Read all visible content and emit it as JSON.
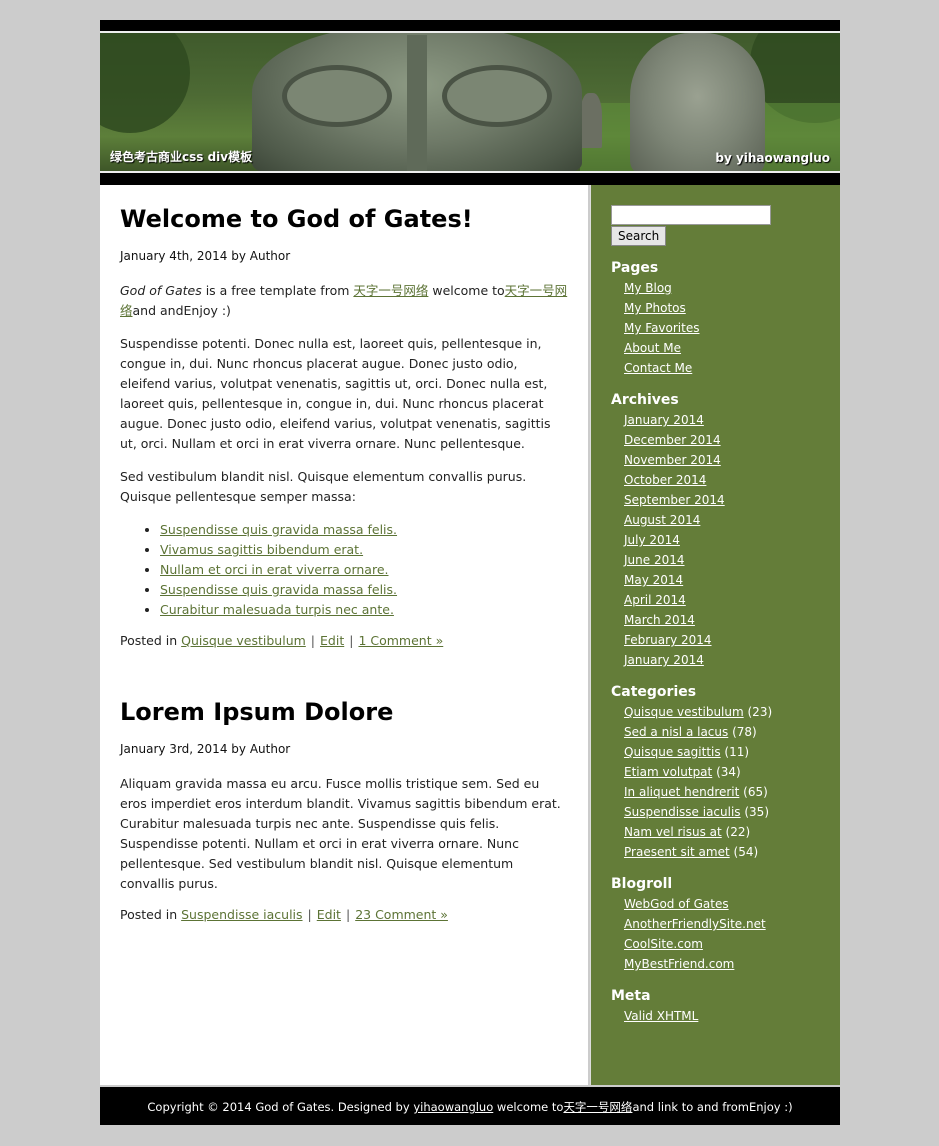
{
  "header": {
    "title": "绿色考古商业css div模板",
    "byline": "by yihaowangluo"
  },
  "posts": [
    {
      "title": "Welcome to God of Gates!",
      "date": "January 4th, 2014",
      "by": " by ",
      "author": "Author",
      "intro": {
        "em": "God of Gates",
        "text1": " is a free template from ",
        "link1": "天字一号网络",
        "text2": " welcome to",
        "link2": "天字一号网络",
        "text3": "and andEnjoy :)"
      },
      "paragraphs": [
        "Suspendisse potenti. Donec nulla est, laoreet quis, pellentesque in, congue in, dui. Nunc rhoncus placerat augue. Donec justo odio, eleifend varius, volutpat venenatis, sagittis ut, orci. Donec nulla est, laoreet quis, pellentesque in, congue in, dui. Nunc rhoncus placerat augue. Donec justo odio, eleifend varius, volutpat venenatis, sagittis ut, orci. Nullam et orci in erat viverra ornare. Nunc pellentesque.",
        "Sed vestibulum blandit nisl. Quisque elementum convallis purus. Quisque pellentesque semper massa:"
      ],
      "list": [
        "Suspendisse quis gravida massa felis.",
        "Vivamus sagittis bibendum erat.",
        "Nullam et orci in erat viverra ornare.",
        "Suspendisse quis gravida massa felis.",
        "Curabitur malesuada turpis nec ante."
      ],
      "posted_in": "Posted in ",
      "category": "Quisque vestibulum",
      "edit": "Edit",
      "comments": "1 Comment »",
      "sep": "|"
    },
    {
      "title": "Lorem Ipsum Dolore",
      "date": "January 3rd, 2014",
      "by": " by ",
      "author": "Author",
      "paragraphs": [
        "Aliquam gravida massa eu arcu. Fusce mollis tristique sem. Sed eu eros imperdiet eros interdum blandit. Vivamus sagittis bibendum erat. Curabitur malesuada turpis nec ante. Suspendisse quis felis. Suspendisse potenti. Nullam et orci in erat viverra ornare. Nunc pellentesque. Sed vestibulum blandit nisl. Quisque elementum convallis purus."
      ],
      "posted_in": "Posted in ",
      "category": "Suspendisse iaculis",
      "edit": "Edit",
      "comments": "23 Comment »",
      "sep": "|"
    }
  ],
  "sidebar": {
    "search_button": "Search",
    "pages_title": "Pages",
    "pages": [
      "My Blog",
      "My Photos",
      "My Favorites",
      "About Me",
      "Contact Me"
    ],
    "archives_title": "Archives",
    "archives": [
      "January 2014",
      "December 2014",
      "November 2014",
      "October 2014",
      "September 2014",
      "August 2014",
      "July 2014",
      "June 2014",
      "May 2014",
      "April 2014",
      "March 2014",
      "February 2014",
      "January 2014"
    ],
    "categories_title": "Categories",
    "categories": [
      {
        "name": "Quisque vestibulum",
        "count": " (23)"
      },
      {
        "name": "Sed a nisl a lacus",
        "count": " (78)"
      },
      {
        "name": "Quisque sagittis",
        "count": " (11)"
      },
      {
        "name": "Etiam volutpat",
        "count": " (34)"
      },
      {
        "name": "In aliquet hendrerit",
        "count": " (65)"
      },
      {
        "name": "Suspendisse iaculis",
        "count": " (35)"
      },
      {
        "name": "Nam vel risus at",
        "count": " (22)"
      },
      {
        "name": "Praesent sit amet",
        "count": " (54)"
      }
    ],
    "blogroll_title": "Blogroll",
    "blogroll": [
      "WebGod of Gates",
      "AnotherFriendlySite.net",
      "CoolSite.com",
      "MyBestFriend.com"
    ],
    "meta_title": "Meta",
    "meta": [
      "Valid XHTML"
    ]
  },
  "footer": {
    "text1": "Copyright © 2014 God of Gates. Designed by ",
    "link1": "yihaowangluo",
    "text2": " welcome to",
    "link2": "天字一号网络",
    "text3": "and link to and fromEnjoy :)"
  }
}
